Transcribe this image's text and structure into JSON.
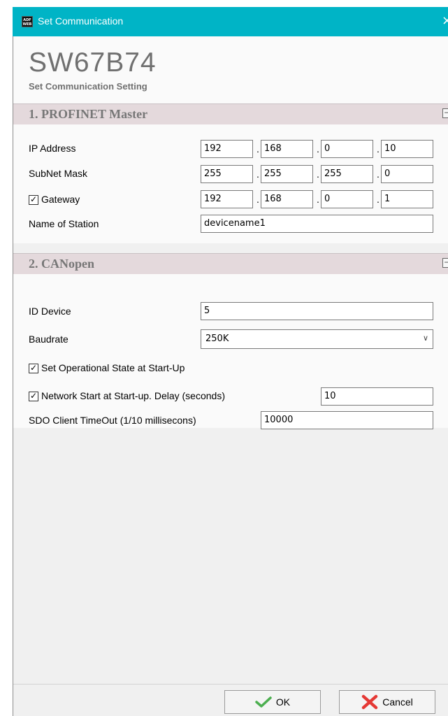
{
  "window": {
    "title": "Set Communication",
    "app_icon_text": "ADF WEB",
    "close_glyph": "×"
  },
  "header": {
    "product": "SW67B74",
    "subtitle": "Set Communication Setting"
  },
  "section1": {
    "title": "1. PROFINET Master",
    "collapse_glyph": "−",
    "ip_label": "IP Address",
    "ip": [
      "192",
      "168",
      "0",
      "10"
    ],
    "mask_label": "SubNet Mask",
    "mask": [
      "255",
      "255",
      "255",
      "0"
    ],
    "gateway_label": "Gateway",
    "gateway_checked": true,
    "gateway": [
      "192",
      "168",
      "0",
      "1"
    ],
    "station_label": "Name of Station",
    "station": "devicename1"
  },
  "section2": {
    "title": "2. CANopen",
    "collapse_glyph": "−",
    "id_label": "ID Device",
    "id_value": "5",
    "baud_label": "Baudrate",
    "baud_value": "250K",
    "opstate_label": "Set Operational State at Start-Up",
    "opstate_checked": true,
    "netstart_label": "Network Start at Start-up. Delay (seconds)",
    "netstart_checked": true,
    "netstart_value": "10",
    "sdo_label": "SDO Client TimeOut (1/10 millisecons)",
    "sdo_value": "10000"
  },
  "footer": {
    "ok_label": "OK",
    "cancel_label": "Cancel"
  },
  "icons": {
    "check": "✓",
    "chevron": "∨"
  },
  "colors": {
    "titlebar": "#00b4c6",
    "section_header": "#e4d9dc",
    "ok_icon": "#4caf50",
    "cancel_icon": "#e53935"
  }
}
